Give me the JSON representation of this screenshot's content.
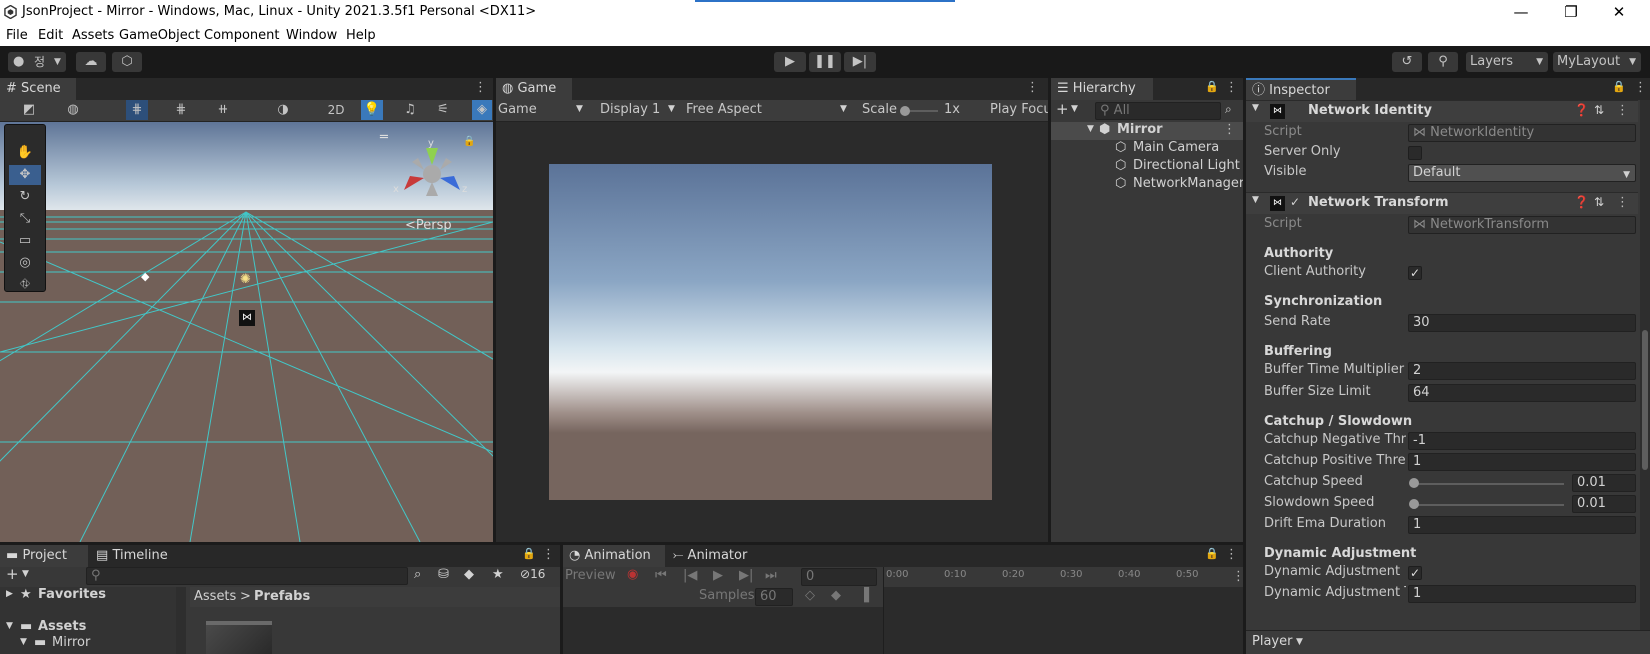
{
  "window": {
    "title": "JsonProject - Mirror - Windows, Mac, Linux - Unity 2021.3.5f1 Personal <DX11>"
  },
  "menu": [
    "File",
    "Edit",
    "Assets",
    "GameObject",
    "Component",
    "Window",
    "Help"
  ],
  "toolbar": {
    "account": "정",
    "layers": "Layers",
    "layout": "MyLayout"
  },
  "scene": {
    "tab": "Scene",
    "mode_2d": "2D",
    "persp": "Persp",
    "axis_x": "x",
    "axis_y": "y",
    "axis_z": "z"
  },
  "game": {
    "tab": "Game",
    "mode": "Game",
    "display": "Display 1",
    "aspect": "Free Aspect",
    "scale_label": "Scale",
    "scale_value": "1x",
    "play_focused": "Play Focu"
  },
  "hierarchy": {
    "tab": "Hierarchy",
    "search_placeholder": "All",
    "scene_name": "Mirror",
    "items": [
      "Main Camera",
      "Directional Light",
      "NetworkManager"
    ]
  },
  "inspector": {
    "tab": "Inspector",
    "identity": {
      "title": "Network Identity",
      "script_label": "Script",
      "script_value": "NetworkIdentity",
      "server_only": "Server Only",
      "visible_label": "Visible",
      "visible_value": "Default"
    },
    "transform": {
      "title": "Network Transform",
      "script_label": "Script",
      "script_value": "NetworkTransform",
      "authority_header": "Authority",
      "client_authority": "Client Authority",
      "sync_header": "Synchronization",
      "send_rate_label": "Send Rate",
      "send_rate": "30",
      "buffering_header": "Buffering",
      "buffer_mult_label": "Buffer Time Multiplier",
      "buffer_mult": "2",
      "buffer_limit_label": "Buffer Size Limit",
      "buffer_limit": "64",
      "catchup_header": "Catchup / Slowdown",
      "catchup_neg_label": "Catchup Negative Thre",
      "catchup_neg": "-1",
      "catchup_pos_label": "Catchup Positive Thre:",
      "catchup_pos": "1",
      "catchup_speed_label": "Catchup Speed",
      "catchup_speed": "0.01",
      "slowdown_speed_label": "Slowdown Speed",
      "slowdown_speed": "0.01",
      "drift_label": "Drift Ema Duration",
      "drift": "1",
      "dyn_header": "Dynamic Adjustment",
      "dyn_label": "Dynamic Adjustment",
      "dyn_t_label": "Dynamic Adjustment T",
      "dyn_t": "1"
    },
    "footer": "Player"
  },
  "project": {
    "tab": "Project",
    "timeline_tab": "Timeline",
    "hidden_count": "16",
    "favorites": "Favorites",
    "assets": "Assets",
    "mirror": "Mirror",
    "breadcrumb_root": "Assets",
    "breadcrumb_leaf": "Prefabs"
  },
  "animation": {
    "tab": "Animation",
    "animator_tab": "Animator",
    "preview": "Preview",
    "frame": "0",
    "samples_label": "Samples",
    "samples": "60",
    "ticks": [
      "0:00",
      "0:10",
      "0:20",
      "0:30",
      "0:40",
      "0:50"
    ]
  },
  "colors": {
    "accent": "#3a79bb",
    "grid": "#3dd3d5",
    "sky_top": "#5d769a",
    "ground": "#76655e"
  }
}
